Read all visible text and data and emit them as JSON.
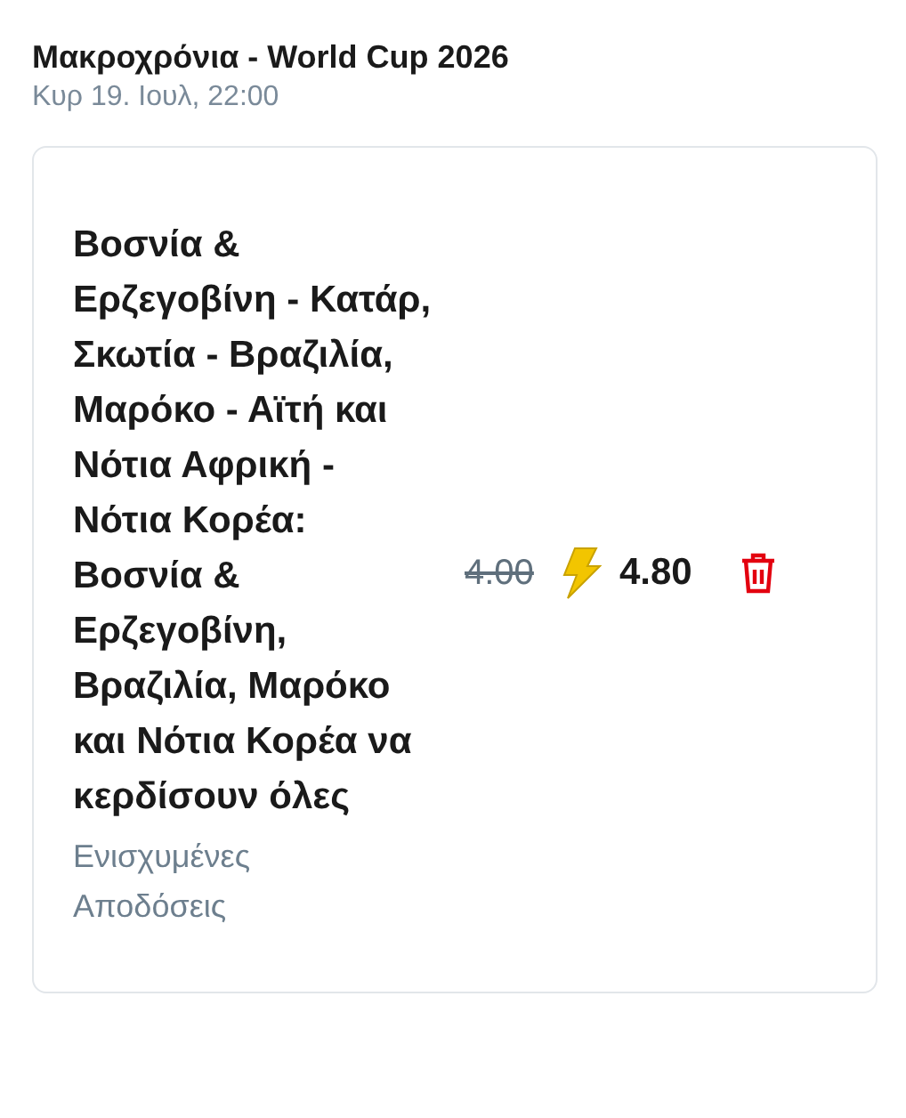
{
  "header": {
    "title": "Μακροχρόνια - World Cup 2026",
    "datetime": "Κυρ 19. Ιουλ, 22:00"
  },
  "selection": {
    "text": "Βοσνία & Ερζεγοβίνη - Κατάρ, Σκωτία - Βραζιλία, Μαρόκο - Αϊτή και Νότια Αφρική - Νότια Κορέα: Βοσνία & Ερζεγοβίνη, Βραζιλία, Μαρόκο και Νότια Κορέα να κερδίσουν όλες",
    "market": "Ενισχυμένες Αποδόσεις",
    "old_odds": "4.00",
    "boosted": true,
    "odds": "4.80"
  }
}
